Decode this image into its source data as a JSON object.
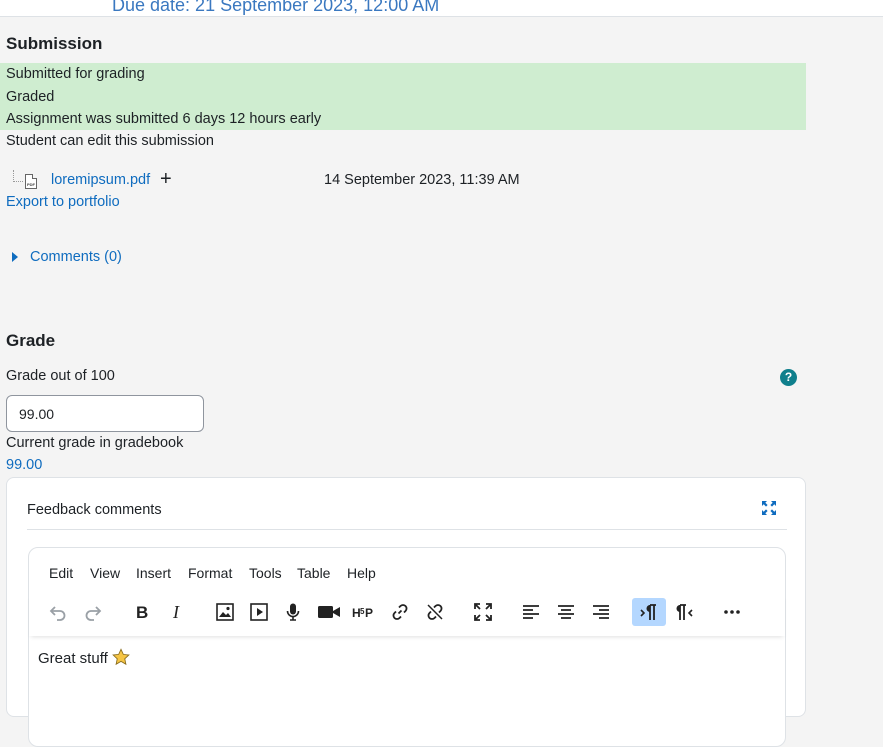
{
  "header": {
    "due_date": "Due date: 21 September 2023, 12:00 AM"
  },
  "submission": {
    "title": "Submission",
    "status_lines": [
      "Submitted for grading",
      "Graded",
      "Assignment was submitted 6 days 12 hours early"
    ],
    "status_color": "#cfedd0",
    "edit_note": "Student can edit this submission",
    "file": {
      "name": "loremipsum.pdf",
      "add_glyph": "+",
      "timestamp": "14 September 2023, 11:39 AM",
      "icon": "pdf-file-icon"
    },
    "export_link": "Export to portfolio",
    "comments_link": "Comments (0)"
  },
  "grade": {
    "title": "Grade",
    "label": "Grade out of 100",
    "help_glyph": "?",
    "value": "99.00",
    "current_label": "Current grade in gradebook",
    "current_value": "99.00"
  },
  "feedback": {
    "title": "Feedback comments",
    "menu": [
      "Edit",
      "View",
      "Insert",
      "Format",
      "Tools",
      "Table",
      "Help"
    ],
    "toolbar_icons": [
      "undo-icon",
      "redo-icon",
      "bold-icon",
      "italic-icon",
      "image-icon",
      "media-icon",
      "microphone-icon",
      "video-camera-icon",
      "h5p-icon",
      "link-icon",
      "unlink-icon",
      "fullscreen-icon",
      "align-left-icon",
      "align-center-icon",
      "align-right-icon",
      "ltr-paragraph-icon",
      "rtl-paragraph-icon",
      "more-icon"
    ],
    "content": "Great stuff",
    "content_emoji": "star-icon"
  },
  "colors": {
    "link": "#0f6cbf",
    "accent_teal": "#0f7f8c",
    "active_button": "#b4d7ff"
  }
}
